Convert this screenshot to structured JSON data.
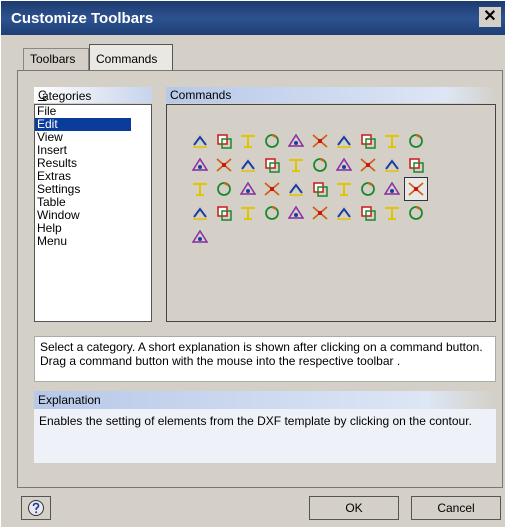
{
  "window": {
    "title": "Customize Toolbars",
    "close_glyph": "✕"
  },
  "tabs": [
    {
      "label": "Toolbars"
    },
    {
      "label": "Commands"
    }
  ],
  "categories": {
    "header": "Categories",
    "items": [
      "File",
      "Edit",
      "View",
      "Insert",
      "Results",
      "Extras",
      "Settings",
      "Table",
      "Window",
      "Help",
      "Menu"
    ],
    "selected": "Edit"
  },
  "commands": {
    "header": "Commands",
    "icons": [
      "undo-icon",
      "redo-icon",
      "copy-icon",
      "paste-icon",
      "new-element-icon",
      "duplicate-icon",
      "mirror-icon",
      "frame-select-icon",
      "edit-shape-icon",
      "insert-node-icon",
      "move-icon",
      "import-icon",
      "extract-icon",
      "text-spacing-icon",
      "rotate-icon",
      "center-icon",
      "align-icon",
      "extend-icon",
      "intersect-icon",
      "distribute-icon",
      "offset-icon",
      "break-icon",
      "trim-icon",
      "join-icon",
      "chamfer-icon",
      "split-icon",
      "grid-insert-icon",
      "array-icon",
      "circle-array-icon",
      "dxf-template-icon",
      "properties-icon",
      "cut-icon",
      "cut-mark-icon",
      "cut-mark-alt-icon",
      "cut-stop-icon",
      "open-path-icon",
      "tag-yellow-icon",
      "tag-yellow-alt-icon",
      "text-a-icon",
      "tag-text-icon",
      "cut-text-icon"
    ],
    "selected_index": 29
  },
  "help_text": "Select a category. A short explanation is shown after clicking on a command button. Drag a command button with the mouse into the respective toolbar .",
  "explanation": {
    "header": "Explanation",
    "text": "Enables the setting of elements from the DXF template by clicking on the contour."
  },
  "buttons": {
    "help_icon": "help-icon",
    "ok": "OK",
    "cancel": "Cancel"
  }
}
